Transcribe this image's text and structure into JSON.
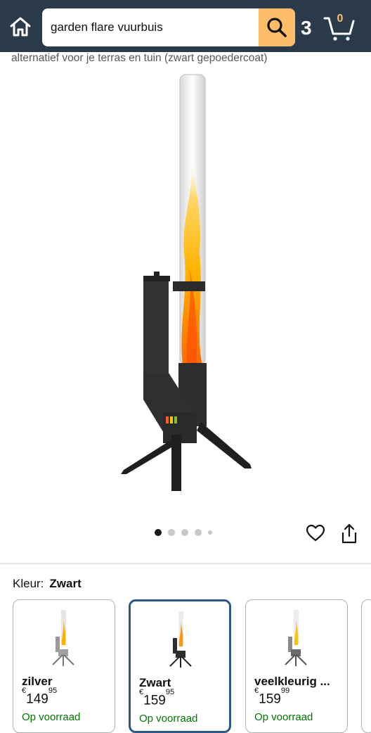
{
  "header": {
    "search_value": "garden flare vuurbuis",
    "cart_count": "0",
    "account_glyph": "3",
    "colors": {
      "bar": "#2b3a4a",
      "search_button": "#febd69"
    }
  },
  "product": {
    "subtitle": "alternatief voor je terras en tuin (zwart gepoedercoat)",
    "image_alt": "Garden flare vuurbuis",
    "image_count": 5,
    "active_image": 1
  },
  "variants": {
    "label": "Kleur:",
    "selected": "Zwart",
    "items": [
      {
        "name": "zilver",
        "currency": "€",
        "price_whole": "149",
        "price_fraction": "95",
        "stock": "Op voorraad",
        "selected": false
      },
      {
        "name": "Zwart",
        "currency": "€",
        "price_whole": "159",
        "price_fraction": "95",
        "stock": "Op voorraad",
        "selected": true
      },
      {
        "name": "veelkleurig ...",
        "currency": "€",
        "price_whole": "159",
        "price_fraction": "99",
        "stock": "Op voorraad",
        "selected": false
      }
    ]
  }
}
